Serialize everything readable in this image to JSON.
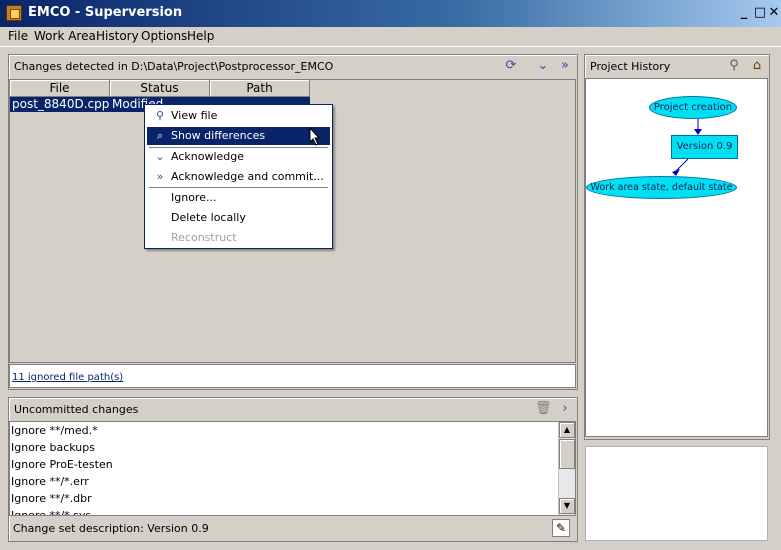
{
  "window": {
    "title": "EMCO - Superversion",
    "controls": [
      "_",
      "□",
      "✕"
    ]
  },
  "menu": [
    "File",
    "Work Area",
    "History",
    "Options",
    "Help"
  ],
  "changes_panel": {
    "title": "Changes detected in D:\\Data\\Project\\Postprocessor_EMCO",
    "columns": [
      "File",
      "Status",
      "Path"
    ],
    "rows": [
      {
        "file": "post_8840D.cpp",
        "status": "Modified",
        "path": ""
      }
    ],
    "ignored_link": "11 ignored file path(s)"
  },
  "context_menu": {
    "items": [
      {
        "label": "View file",
        "icon": "binoculars-icon"
      },
      {
        "label": "Show differences",
        "icon": "magnifier-icon",
        "highlighted": true
      },
      {
        "label": "Acknowledge",
        "icon": "chevron-down-icon"
      },
      {
        "label": "Acknowledge and commit...",
        "icon": "double-chevron-right-icon"
      },
      {
        "label": "Ignore..."
      },
      {
        "label": "Delete locally"
      },
      {
        "label": "Reconstruct",
        "disabled": true
      }
    ]
  },
  "uncommitted_panel": {
    "title": "Uncommitted changes",
    "items": [
      "Ignore **/med.*",
      "Ignore backups",
      "Ignore ProE-testen",
      "Ignore **/*.err",
      "Ignore **/*.dbr",
      "Ignore **/*.sys"
    ],
    "change_set_description": "Change set description: Version 0.9"
  },
  "history_panel": {
    "title": "Project History",
    "nodes": {
      "creation": "Project creation",
      "version": "Version 0.9",
      "work_area": "Work area state, default state"
    }
  },
  "colors": {
    "selection": "#0a246a",
    "node_fill": "#00e0f0",
    "title_gradient_start": "#0a246a"
  }
}
